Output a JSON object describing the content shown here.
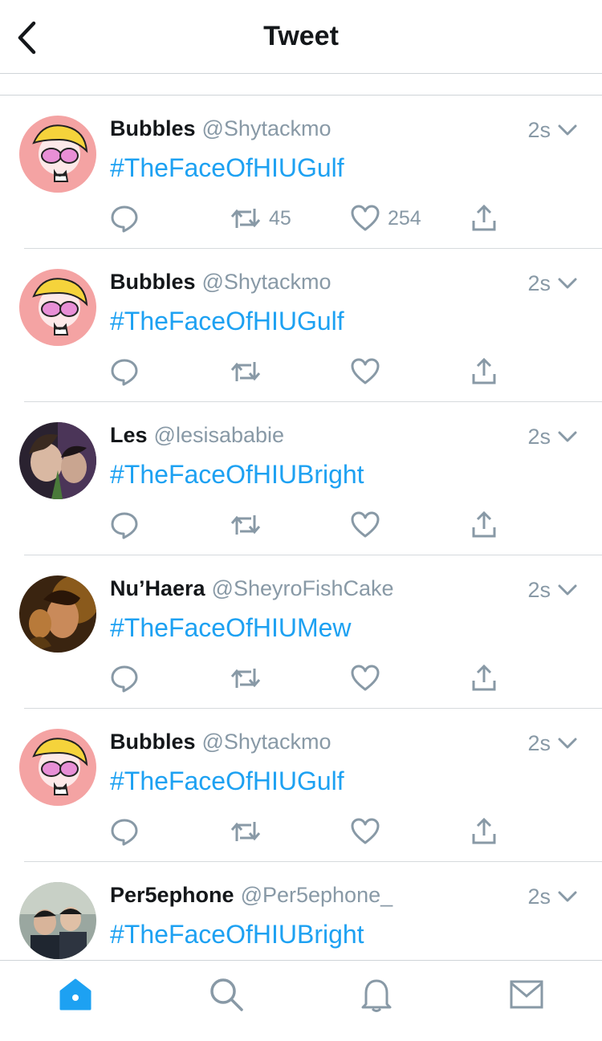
{
  "header": {
    "title": "Tweet",
    "back_icon": "chevron-left-icon"
  },
  "colors": {
    "link": "#1da1f2",
    "muted": "#8899a6",
    "text": "#14171a",
    "active_tab": "#1da1f2"
  },
  "tweets": [
    {
      "name": "Bubbles",
      "handle": "@Shytackmo",
      "time": "2s",
      "text": "#TheFaceOfHIUGulf",
      "retweets": "45",
      "likes": "254",
      "avatar": "bubbles"
    },
    {
      "name": "Bubbles",
      "handle": "@Shytackmo",
      "time": "2s",
      "text": "#TheFaceOfHIUGulf",
      "retweets": "",
      "likes": "",
      "avatar": "bubbles"
    },
    {
      "name": "Les",
      "handle": "@lesisababie",
      "time": "2s",
      "text": "#TheFaceOfHIUBright",
      "retweets": "",
      "likes": "",
      "avatar": "photo-dark"
    },
    {
      "name": "Nu’Haera",
      "handle": "@SheyroFishCake",
      "time": "2s",
      "text": "#TheFaceOfHIUMew",
      "retweets": "",
      "likes": "",
      "avatar": "photo-warm"
    },
    {
      "name": "Bubbles",
      "handle": "@Shytackmo",
      "time": "2s",
      "text": "#TheFaceOfHIUGulf",
      "retweets": "",
      "likes": "",
      "avatar": "bubbles"
    },
    {
      "name": "Per5ephone",
      "handle": "@Per5ephone_",
      "time": "2s",
      "text": "#TheFaceOfHIUBright",
      "retweets": "",
      "likes": "",
      "avatar": "photo-group"
    }
  ],
  "tabbar": [
    {
      "icon": "home-icon",
      "active": true
    },
    {
      "icon": "search-icon",
      "active": false
    },
    {
      "icon": "bell-icon",
      "active": false
    },
    {
      "icon": "mail-icon",
      "active": false
    }
  ]
}
